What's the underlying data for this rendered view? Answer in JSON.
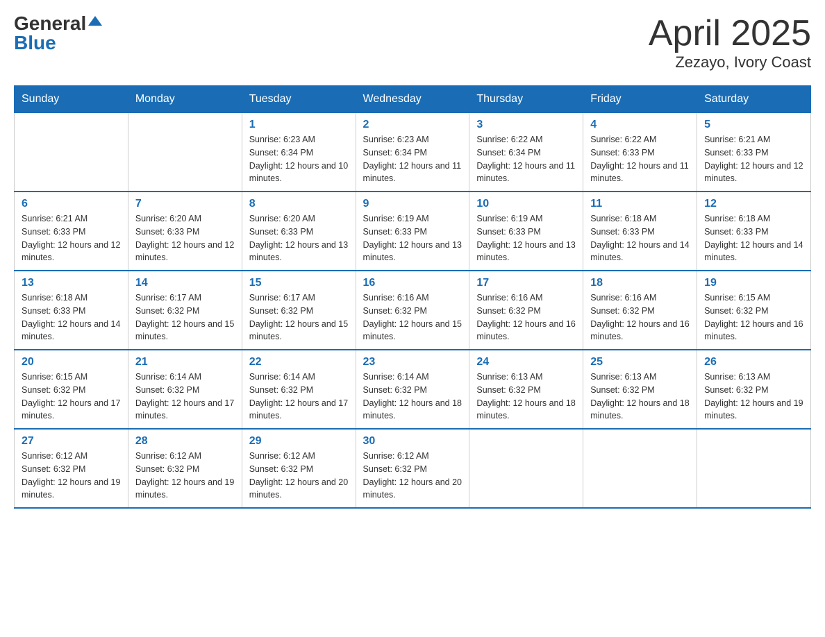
{
  "header": {
    "logo_general": "General",
    "logo_blue": "Blue",
    "month_title": "April 2025",
    "location": "Zezayo, Ivory Coast"
  },
  "days_of_week": [
    "Sunday",
    "Monday",
    "Tuesday",
    "Wednesday",
    "Thursday",
    "Friday",
    "Saturday"
  ],
  "weeks": [
    [
      {
        "num": "",
        "sunrise": "",
        "sunset": "",
        "daylight": ""
      },
      {
        "num": "",
        "sunrise": "",
        "sunset": "",
        "daylight": ""
      },
      {
        "num": "1",
        "sunrise": "Sunrise: 6:23 AM",
        "sunset": "Sunset: 6:34 PM",
        "daylight": "Daylight: 12 hours and 10 minutes."
      },
      {
        "num": "2",
        "sunrise": "Sunrise: 6:23 AM",
        "sunset": "Sunset: 6:34 PM",
        "daylight": "Daylight: 12 hours and 11 minutes."
      },
      {
        "num": "3",
        "sunrise": "Sunrise: 6:22 AM",
        "sunset": "Sunset: 6:34 PM",
        "daylight": "Daylight: 12 hours and 11 minutes."
      },
      {
        "num": "4",
        "sunrise": "Sunrise: 6:22 AM",
        "sunset": "Sunset: 6:33 PM",
        "daylight": "Daylight: 12 hours and 11 minutes."
      },
      {
        "num": "5",
        "sunrise": "Sunrise: 6:21 AM",
        "sunset": "Sunset: 6:33 PM",
        "daylight": "Daylight: 12 hours and 12 minutes."
      }
    ],
    [
      {
        "num": "6",
        "sunrise": "Sunrise: 6:21 AM",
        "sunset": "Sunset: 6:33 PM",
        "daylight": "Daylight: 12 hours and 12 minutes."
      },
      {
        "num": "7",
        "sunrise": "Sunrise: 6:20 AM",
        "sunset": "Sunset: 6:33 PM",
        "daylight": "Daylight: 12 hours and 12 minutes."
      },
      {
        "num": "8",
        "sunrise": "Sunrise: 6:20 AM",
        "sunset": "Sunset: 6:33 PM",
        "daylight": "Daylight: 12 hours and 13 minutes."
      },
      {
        "num": "9",
        "sunrise": "Sunrise: 6:19 AM",
        "sunset": "Sunset: 6:33 PM",
        "daylight": "Daylight: 12 hours and 13 minutes."
      },
      {
        "num": "10",
        "sunrise": "Sunrise: 6:19 AM",
        "sunset": "Sunset: 6:33 PM",
        "daylight": "Daylight: 12 hours and 13 minutes."
      },
      {
        "num": "11",
        "sunrise": "Sunrise: 6:18 AM",
        "sunset": "Sunset: 6:33 PM",
        "daylight": "Daylight: 12 hours and 14 minutes."
      },
      {
        "num": "12",
        "sunrise": "Sunrise: 6:18 AM",
        "sunset": "Sunset: 6:33 PM",
        "daylight": "Daylight: 12 hours and 14 minutes."
      }
    ],
    [
      {
        "num": "13",
        "sunrise": "Sunrise: 6:18 AM",
        "sunset": "Sunset: 6:33 PM",
        "daylight": "Daylight: 12 hours and 14 minutes."
      },
      {
        "num": "14",
        "sunrise": "Sunrise: 6:17 AM",
        "sunset": "Sunset: 6:32 PM",
        "daylight": "Daylight: 12 hours and 15 minutes."
      },
      {
        "num": "15",
        "sunrise": "Sunrise: 6:17 AM",
        "sunset": "Sunset: 6:32 PM",
        "daylight": "Daylight: 12 hours and 15 minutes."
      },
      {
        "num": "16",
        "sunrise": "Sunrise: 6:16 AM",
        "sunset": "Sunset: 6:32 PM",
        "daylight": "Daylight: 12 hours and 15 minutes."
      },
      {
        "num": "17",
        "sunrise": "Sunrise: 6:16 AM",
        "sunset": "Sunset: 6:32 PM",
        "daylight": "Daylight: 12 hours and 16 minutes."
      },
      {
        "num": "18",
        "sunrise": "Sunrise: 6:16 AM",
        "sunset": "Sunset: 6:32 PM",
        "daylight": "Daylight: 12 hours and 16 minutes."
      },
      {
        "num": "19",
        "sunrise": "Sunrise: 6:15 AM",
        "sunset": "Sunset: 6:32 PM",
        "daylight": "Daylight: 12 hours and 16 minutes."
      }
    ],
    [
      {
        "num": "20",
        "sunrise": "Sunrise: 6:15 AM",
        "sunset": "Sunset: 6:32 PM",
        "daylight": "Daylight: 12 hours and 17 minutes."
      },
      {
        "num": "21",
        "sunrise": "Sunrise: 6:14 AM",
        "sunset": "Sunset: 6:32 PM",
        "daylight": "Daylight: 12 hours and 17 minutes."
      },
      {
        "num": "22",
        "sunrise": "Sunrise: 6:14 AM",
        "sunset": "Sunset: 6:32 PM",
        "daylight": "Daylight: 12 hours and 17 minutes."
      },
      {
        "num": "23",
        "sunrise": "Sunrise: 6:14 AM",
        "sunset": "Sunset: 6:32 PM",
        "daylight": "Daylight: 12 hours and 18 minutes."
      },
      {
        "num": "24",
        "sunrise": "Sunrise: 6:13 AM",
        "sunset": "Sunset: 6:32 PM",
        "daylight": "Daylight: 12 hours and 18 minutes."
      },
      {
        "num": "25",
        "sunrise": "Sunrise: 6:13 AM",
        "sunset": "Sunset: 6:32 PM",
        "daylight": "Daylight: 12 hours and 18 minutes."
      },
      {
        "num": "26",
        "sunrise": "Sunrise: 6:13 AM",
        "sunset": "Sunset: 6:32 PM",
        "daylight": "Daylight: 12 hours and 19 minutes."
      }
    ],
    [
      {
        "num": "27",
        "sunrise": "Sunrise: 6:12 AM",
        "sunset": "Sunset: 6:32 PM",
        "daylight": "Daylight: 12 hours and 19 minutes."
      },
      {
        "num": "28",
        "sunrise": "Sunrise: 6:12 AM",
        "sunset": "Sunset: 6:32 PM",
        "daylight": "Daylight: 12 hours and 19 minutes."
      },
      {
        "num": "29",
        "sunrise": "Sunrise: 6:12 AM",
        "sunset": "Sunset: 6:32 PM",
        "daylight": "Daylight: 12 hours and 20 minutes."
      },
      {
        "num": "30",
        "sunrise": "Sunrise: 6:12 AM",
        "sunset": "Sunset: 6:32 PM",
        "daylight": "Daylight: 12 hours and 20 minutes."
      },
      {
        "num": "",
        "sunrise": "",
        "sunset": "",
        "daylight": ""
      },
      {
        "num": "",
        "sunrise": "",
        "sunset": "",
        "daylight": ""
      },
      {
        "num": "",
        "sunrise": "",
        "sunset": "",
        "daylight": ""
      }
    ]
  ]
}
